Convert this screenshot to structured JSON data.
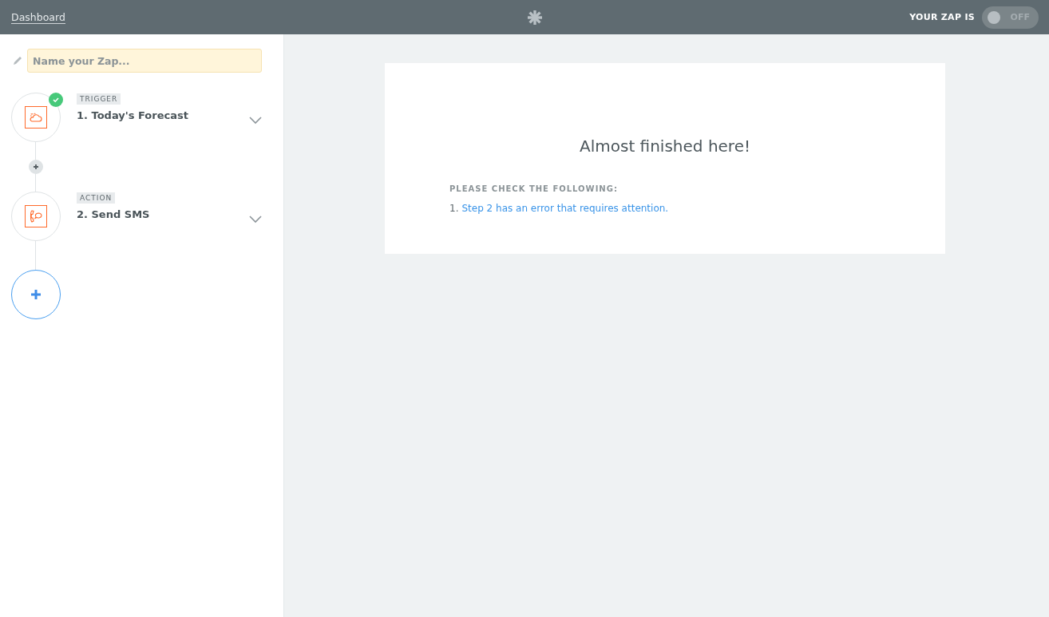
{
  "header": {
    "dashboard_link": "Dashboard",
    "status_label": "YOUR ZAP IS",
    "toggle": {
      "on": false,
      "label": "OFF"
    }
  },
  "zap_name": {
    "placeholder": "Name your Zap..."
  },
  "steps": [
    {
      "kind": "trigger",
      "tag": "TRIGGER",
      "title": "1. Today's Forecast",
      "checked": true,
      "expanded": false
    },
    {
      "kind": "action",
      "tag": "ACTION",
      "title": "2. Send SMS",
      "checked": false,
      "expanded": false
    }
  ],
  "add_step": {
    "highlighted": true
  },
  "panel": {
    "heading": "Almost finished here!",
    "subheading": "PLEASE CHECK THE FOLLOWING:",
    "issues": [
      {
        "number": "1.",
        "text": "Step 2 has an error that requires attention."
      }
    ]
  }
}
